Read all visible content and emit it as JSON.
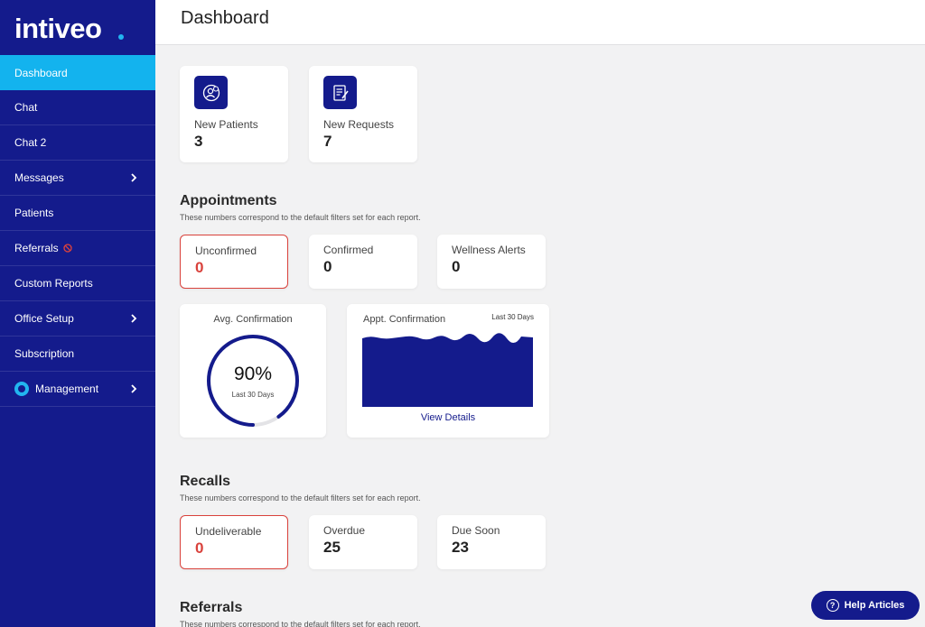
{
  "brand": {
    "logo_text": "intiveo"
  },
  "sidebar": {
    "items": [
      {
        "label": "Dashboard"
      },
      {
        "label": "Chat"
      },
      {
        "label": "Chat 2"
      },
      {
        "label": "Messages"
      },
      {
        "label": "Patients"
      },
      {
        "label": "Referrals"
      },
      {
        "label": "Custom Reports"
      },
      {
        "label": "Office Setup"
      },
      {
        "label": "Subscription"
      },
      {
        "label": "Management"
      }
    ]
  },
  "header": {
    "title": "Dashboard"
  },
  "stats": {
    "new_patients": {
      "label": "New Patients",
      "value": "3"
    },
    "new_requests": {
      "label": "New Requests",
      "value": "7"
    }
  },
  "appointments": {
    "title": "Appointments",
    "subtitle": "These numbers correspond to the default filters set for each report.",
    "unconfirmed": {
      "label": "Unconfirmed",
      "value": "0"
    },
    "confirmed": {
      "label": "Confirmed",
      "value": "0"
    },
    "wellness": {
      "label": "Wellness Alerts",
      "value": "0"
    },
    "avg_confirmation": {
      "title": "Avg. Confirmation",
      "value": "90%",
      "percent": 90,
      "subtitle": "Last 30 Days"
    },
    "appt_confirmation": {
      "title": "Appt. Confirmation",
      "range": "Last 30 Days",
      "link": "View Details"
    }
  },
  "recalls": {
    "title": "Recalls",
    "subtitle": "These numbers correspond to the default filters set for each report.",
    "undeliverable": {
      "label": "Undeliverable",
      "value": "0"
    },
    "overdue": {
      "label": "Overdue",
      "value": "25"
    },
    "due_soon": {
      "label": "Due Soon",
      "value": "23"
    }
  },
  "referrals": {
    "title": "Referrals",
    "subtitle": "These numbers correspond to the default filters set for each report."
  },
  "help": {
    "label": "Help Articles"
  },
  "colors": {
    "brand_navy": "#141b8c",
    "accent_cyan": "#13b3ee",
    "alert_red": "#d9423c"
  }
}
